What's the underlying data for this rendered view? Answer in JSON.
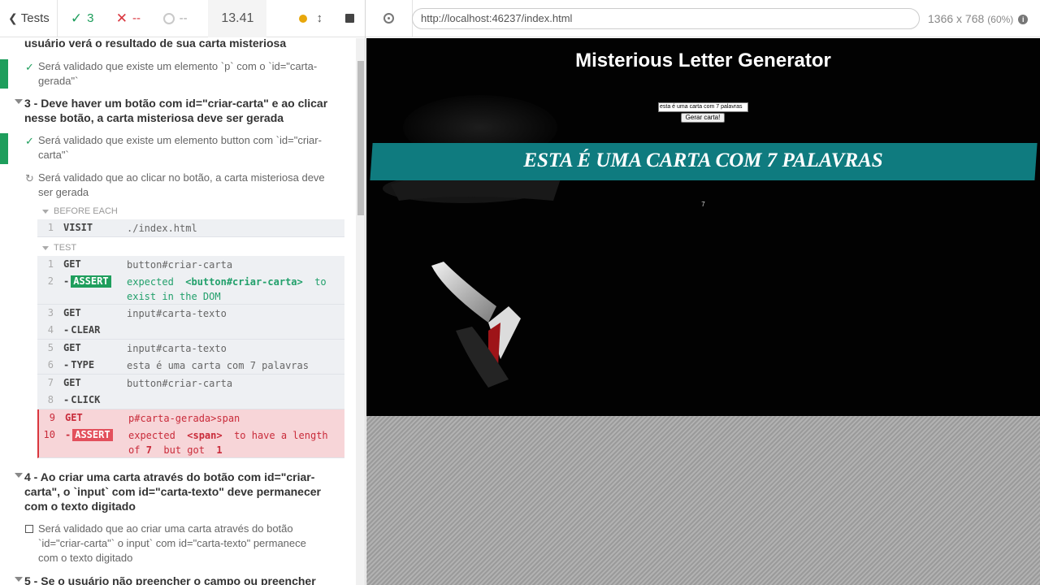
{
  "reporter": {
    "tests_label": "Tests",
    "passed_count": "3",
    "failed_count": "--",
    "pending_count": "--",
    "duration": "13.41"
  },
  "suites": [
    {
      "title": "usuário verá o resultado de sua carta misteriosa"
    },
    {
      "title": "3 - Deve haver um botão com id=\"criar-carta\" e ao clicar nesse botão, a carta misteriosa deve ser gerada"
    },
    {
      "title": "4 - Ao criar uma carta através do botão com id=\"criar-carta\", o `input` com id=\"carta-texto\" deve permanecer com o texto digitado"
    },
    {
      "title": "5 - Se o usuário não preencher o campo ou preencher com"
    }
  ],
  "tests": [
    {
      "title": "Será validado que existe um elemento `p` com o `id=\"carta-gerada\"`",
      "state": "passed"
    },
    {
      "title": "Será validado que existe um elemento button com `id=\"criar-carta\"`",
      "state": "passed"
    },
    {
      "title": "Será validado que ao clicar no botão, a carta misteriosa deve ser gerada",
      "state": "running"
    },
    {
      "title": "Será validado que ao criar uma carta através do botão `id=\"criar-carta\"` o input` com id=\"carta-texto\" permanece com o texto digitado",
      "state": "pending"
    }
  ],
  "hooks": {
    "before_each": "BEFORE EACH",
    "test": "TEST"
  },
  "commands": {
    "before": [
      {
        "num": "1",
        "name": "VISIT",
        "msg": "./index.html"
      }
    ],
    "test": [
      {
        "num": "1",
        "name": "GET",
        "msg": "button#criar-carta"
      },
      {
        "num": "2",
        "name": "ASSERT",
        "msg_parts": [
          "expected",
          "<button#criar-carta>",
          "to",
          "exist in the DOM"
        ]
      },
      {
        "num": "3",
        "name": "GET",
        "msg": "input#carta-texto"
      },
      {
        "num": "4",
        "name": "CLEAR",
        "msg": ""
      },
      {
        "num": "5",
        "name": "GET",
        "msg": "input#carta-texto"
      },
      {
        "num": "6",
        "name": "TYPE",
        "msg": "esta é uma carta com 7 palavras"
      },
      {
        "num": "7",
        "name": "GET",
        "msg": "button#criar-carta"
      },
      {
        "num": "8",
        "name": "CLICK",
        "msg": ""
      },
      {
        "num": "9",
        "name": "GET",
        "msg": "p#carta-gerada>span"
      },
      {
        "num": "10",
        "name": "ASSERT",
        "msg_parts": [
          "expected",
          "<span>",
          "to have a length of",
          "7",
          "but got",
          "1"
        ]
      }
    ]
  },
  "aut": {
    "url": "http://localhost:46237/index.html",
    "viewport": "1366 x 768",
    "scale": "(60%)",
    "info_icon": "i"
  },
  "app": {
    "title": "Misterious Letter Generator",
    "input_value": "esta é uma carta com 7 palavras",
    "button_label": "Gerar carta!",
    "letter": "ESTA É UMA CARTA COM 7 PALAVRAS",
    "word_count": "7"
  },
  "colors": {
    "pass": "#1e9e5c",
    "fail": "#d9363e",
    "banner": "#0f7b7f"
  }
}
